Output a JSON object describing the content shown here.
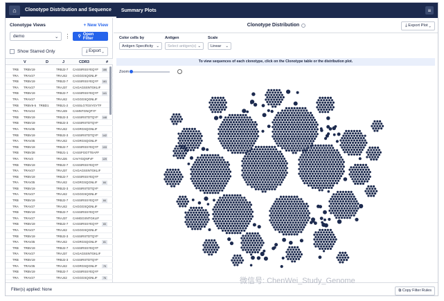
{
  "nav": {
    "home_icon": "home-icon",
    "tabs": [
      {
        "label": "Clonotype Distribution and Sequence",
        "active": true
      },
      {
        "label": "Summary Plots",
        "active": false
      }
    ]
  },
  "sidebar": {
    "title": "Clonotype Views",
    "new_view": "+ New View",
    "selected_view": "demo",
    "open_filter": "Open Filter",
    "show_starred": "Show Starred Only",
    "export": "Export",
    "columns": [
      "V",
      "D",
      "J",
      "CDR3",
      "#"
    ],
    "rows": [
      {
        "a": "TRB",
        "v": "TRBV19",
        "d": "",
        "j": "TRBJ2-7",
        "cdr3": "CASSIRSSYEQYF"
      },
      {
        "a": "TRA",
        "v": "TRAV27",
        "d": "",
        "j": "TRAJ42",
        "cdr3": "CAGGGSQGNLIF"
      },
      {
        "a": "TRB",
        "v": "TRBV19",
        "d": "",
        "j": "TRBJ2-7",
        "cdr3": "CASSIRSSYEQYF"
      },
      {
        "a": "TRA",
        "v": "TRAV27",
        "d": "",
        "j": "TRAJ37",
        "cdr3": "CAGAGSSNTGKLIF"
      },
      {
        "a": "TRB",
        "v": "TRBV19",
        "d": "",
        "j": "TRBJ2-7",
        "cdr3": "CASSIRSSYEQYF"
      },
      {
        "a": "TRA",
        "v": "TRAV27",
        "d": "",
        "j": "TRAJ42",
        "cdr3": "CAGGGSQGNLIF"
      },
      {
        "a": "TRB",
        "v": "TRBV6-5",
        "d": "TRBD1",
        "j": "TRBJ1-2",
        "cdr3": "CASSLGTGSYGYTF"
      },
      {
        "a": "TRA",
        "v": "TRAV24",
        "d": "",
        "j": "TRAJ49",
        "cdr3": "CAMNTGNQFYF"
      },
      {
        "a": "TRB",
        "v": "TRBV19",
        "d": "",
        "j": "TRBJ2-3",
        "cdr3": "CASSIRSTDTQYF"
      },
      {
        "a": "TRB",
        "v": "TRBV19",
        "d": "",
        "j": "TRBJ2-3",
        "cdr3": "CASSIRSTDTQYF"
      },
      {
        "a": "TRA",
        "v": "TRAV35",
        "d": "",
        "j": "TRAJ42",
        "cdr3": "CAGRGSQGNLIF"
      },
      {
        "a": "TRB",
        "v": "TRBV19",
        "d": "",
        "j": "TRBJ2-3",
        "cdr3": "CASSIRSTDTQYF"
      },
      {
        "a": "TRA",
        "v": "TRAV35",
        "d": "",
        "j": "TRAJ42",
        "cdr3": "CAGRGSQGNLIF"
      },
      {
        "a": "TRB",
        "v": "TRBV19",
        "d": "",
        "j": "TRBJ2-7",
        "cdr3": "CASSIRSSYEQYF"
      },
      {
        "a": "TRB",
        "v": "TRBV28",
        "d": "",
        "j": "TRBJ1-1",
        "cdr3": "CASSFGGTTEAFF"
      },
      {
        "a": "TRA",
        "v": "TRAV3",
        "d": "",
        "j": "TRAJ26",
        "cdr3": "CAVYGQNFVF"
      },
      {
        "a": "TRB",
        "v": "TRBV19",
        "d": "",
        "j": "TRBJ2-7",
        "cdr3": "CASSIRSSYEQYF"
      },
      {
        "a": "TRA",
        "v": "TRAV27",
        "d": "",
        "j": "TRAJ37",
        "cdr3": "CAGAGSSNTGKLIF"
      },
      {
        "a": "TRB",
        "v": "TRBV19",
        "d": "",
        "j": "TRBJ2-7",
        "cdr3": "CASSIRSSYEQYF"
      },
      {
        "a": "TRA",
        "v": "TRAV35",
        "d": "",
        "j": "TRAJ42",
        "cdr3": "CAGRGSQGNLIF"
      },
      {
        "a": "TRB",
        "v": "TRBV19",
        "d": "",
        "j": "TRBJ2-3",
        "cdr3": "CASSIRSTDTQYF"
      },
      {
        "a": "TRA",
        "v": "TRAV27",
        "d": "",
        "j": "TRAJ42",
        "cdr3": "CAGGGSQGNLIF"
      },
      {
        "a": "TRB",
        "v": "TRBV19",
        "d": "",
        "j": "TRBJ2-7",
        "cdr3": "CASSIRSSYEQYF"
      },
      {
        "a": "TRA",
        "v": "TRAV27",
        "d": "",
        "j": "TRAJ42",
        "cdr3": "CAGGGSQGNLIF"
      },
      {
        "a": "TRB",
        "v": "TRBV19",
        "d": "",
        "j": "TRBJ2-7",
        "cdr3": "CASSIRSSYEQYF"
      },
      {
        "a": "TRA",
        "v": "TRAV27",
        "d": "",
        "j": "TRAJ37",
        "cdr3": "CAMGGSNTGKLIF"
      },
      {
        "a": "TRB",
        "v": "TRBV19",
        "d": "",
        "j": "TRBJ2-7",
        "cdr3": "CASSIRSSYEQYF"
      },
      {
        "a": "TRA",
        "v": "TRAV27",
        "d": "",
        "j": "TRAJ42",
        "cdr3": "CAGGGSQGNLIF"
      },
      {
        "a": "TRB",
        "v": "TRBV19",
        "d": "",
        "j": "TRBJ2-3",
        "cdr3": "CASSIRSTDTQYF"
      },
      {
        "a": "TRA",
        "v": "TRAV35",
        "d": "",
        "j": "TRAJ42",
        "cdr3": "CAGRGSQGNLIF"
      },
      {
        "a": "TRB",
        "v": "TRBV19",
        "d": "",
        "j": "TRBJ2-7",
        "cdr3": "CASSIRSSYEQYF"
      },
      {
        "a": "TRA",
        "v": "TRAV27",
        "d": "",
        "j": "TRAJ37",
        "cdr3": "CAGAGSSNTGKLIF"
      },
      {
        "a": "TRB",
        "v": "TRBV19",
        "d": "",
        "j": "TRBJ2-3",
        "cdr3": "CASSIRSTDTQYF"
      },
      {
        "a": "TRA",
        "v": "TRAV35",
        "d": "",
        "j": "TRAJ42",
        "cdr3": "CAGRGSQGNLIF"
      },
      {
        "a": "TRB",
        "v": "TRBV19",
        "d": "",
        "j": "TRBJ2-7",
        "cdr3": "CASSIRSSYEQYF"
      },
      {
        "a": "TRA",
        "v": "TRAV27",
        "d": "",
        "j": "TRAJ42",
        "cdr3": "CAGGGSQGNLIF"
      }
    ],
    "counts": [
      "186",
      "",
      "161",
      "",
      "141",
      "",
      "",
      "",
      "148",
      "",
      "",
      "142",
      "",
      "133",
      "",
      "129",
      "",
      "",
      "",
      "84",
      "",
      "",
      "84",
      "",
      "",
      "",
      "83",
      "",
      "",
      "81",
      "",
      "",
      "",
      "79",
      "",
      "76"
    ]
  },
  "main": {
    "title": "Clonotype Distribution",
    "export_plot": "Export Plot",
    "color_by_label": "Color cells by",
    "color_by_value": "Antigen Specificity",
    "antigen_label": "Antigen",
    "antigen_placeholder": "Select antigen(s)",
    "scale_label": "Scale",
    "scale_value": "Linear",
    "banner": "To view sequences of each clonotype, click on the Clonotype table or the distribution plot.",
    "zoom_label": "Zoom"
  },
  "footer": {
    "filters_applied": "Filter(s) applied: None",
    "copy_filter": "Copy Filter Rules"
  },
  "watermark": "微信号: ChenWei_Study_Genome",
  "colors": {
    "nav": "#1c2a4e",
    "accent": "#2563eb",
    "cell": "#1c2a4e"
  }
}
